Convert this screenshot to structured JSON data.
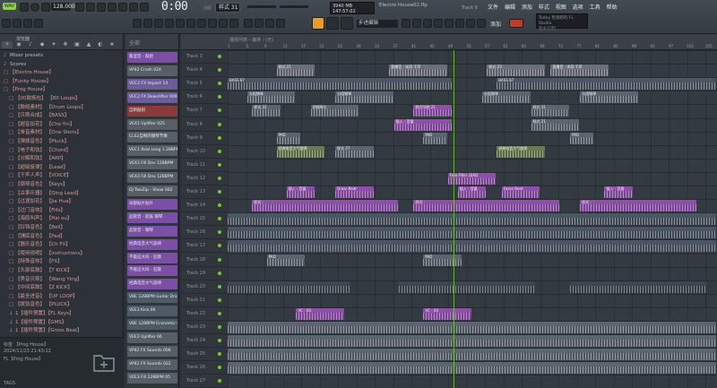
{
  "toolbar": {
    "wave_badge": "WAV",
    "bpm": "128.000",
    "time": "0:00",
    "time_sub": ":00",
    "pattern": "样式 31",
    "cpu_line1": "3940 MB",
    "cpu_line2": "147:57:02",
    "project_title": "Electro House02.flp",
    "track_indicator": "Track 9",
    "step_edit": "步进编辑",
    "add_label": "添加",
    "menu": [
      "文件",
      "编辑",
      "添加",
      "样式",
      "视图",
      "选项",
      "工具",
      "帮助"
    ],
    "news_line1": "Today 检测新的 FL Studio",
    "news_line2": "版本可用!"
  },
  "browser": {
    "title": "浏览器",
    "tabs": [
      "+",
      "◉",
      "♪",
      "◆",
      "✦",
      "❖",
      "▣",
      "▲",
      "◐",
      "★"
    ],
    "items": [
      {
        "glyph": "♪",
        "label": "Mixer presets"
      },
      {
        "glyph": "♪",
        "label": "Scores"
      },
      {
        "glyph": "□",
        "label": "【Electro House】"
      },
      {
        "glyph": "□",
        "label": "【Funky House】"
      },
      {
        "glyph": "□",
        "label": "【Prog House】"
      },
      {
        "glyph": "□",
        "label": "【00鼓族包】 【8X Loops】"
      },
      {
        "glyph": "□",
        "label": "【鼓组素材】 【Drum Loops】"
      },
      {
        "glyph": "□",
        "label": "【贝斯合成】 【BASS】"
      },
      {
        "glyph": "□",
        "label": "【超音加花】 【Che Yin】"
      },
      {
        "glyph": "□",
        "label": "【单音素材】 【One Shots】"
      },
      {
        "glyph": "□",
        "label": "【弹拨音色】 【Pluck】"
      },
      {
        "glyph": "□",
        "label": "【电子和弦】 【Chord】"
      },
      {
        "glyph": "□",
        "label": "【分解和弦】 【ARP】"
      },
      {
        "glyph": "□",
        "label": "【超级旋律】 【Lead】"
      },
      {
        "glyph": "□",
        "label": "【干声人声】 【VOICE】"
      },
      {
        "glyph": "□",
        "label": "【钢琴音色】 【Keys】"
      },
      {
        "glyph": "□",
        "label": "【古筝乐器】 【Qing Lead】"
      },
      {
        "glyph": "□",
        "label": "【过渡加花】 【Jia Hua】"
      },
      {
        "glyph": "□",
        "label": "【过门音效】 【Fills】"
      },
      {
        "glyph": "□",
        "label": "【海鸥叫声】 【Hai ou】"
      },
      {
        "glyph": "□",
        "label": "【铃铛音色】 【Bell】"
      },
      {
        "glyph": "□",
        "label": "【铺底音色】 【Pad】"
      },
      {
        "glyph": "□",
        "label": "【器乐音色】 【Ch FX】"
      },
      {
        "glyph": "□",
        "label": "【使用说明】 【instructions】"
      },
      {
        "glyph": "□",
        "label": "【特殊音效】 【FX】"
      },
      {
        "glyph": "□",
        "label": "【头部底鼓】 【T KICK】"
      },
      {
        "glyph": "□",
        "label": "【秀音贝斯】 【Wang Ying】"
      },
      {
        "glyph": "□",
        "label": "【中间底鼓】 【Z KICK】"
      },
      {
        "glyph": "□",
        "label": "【最全进音】 【UP LOOP】"
      },
      {
        "glyph": "□",
        "label": "【拨弦音色】 【PLUCK】"
      },
      {
        "glyph": "↓",
        "label": "1【插件预置】【FL Keys】"
      },
      {
        "glyph": "↓",
        "label": "1【插件预置】【GMS】"
      },
      {
        "glyph": "↓",
        "label": "1【插件预置】【Gross Beat】"
      }
    ],
    "footer_line1": "标签 【Prog House】",
    "footer_line2": "2024/11/23 21:43:12",
    "footer_line3": "FL【Prog House】",
    "tags": "TAGS"
  },
  "channels": {
    "head": "全部",
    "items": [
      {
        "label": "集混音 - 鼓组",
        "color": "#7b4fa3"
      },
      {
        "label": "VP42 Crash 024",
        "color": "#585e66"
      },
      {
        "label": "VEC2 FX Impact 14",
        "color": "#6c5d9a"
      },
      {
        "label": "VEC2 FX Downlifter 009",
        "color": "#6c5d9a"
      },
      {
        "label": "自制鼓组",
        "color": "#8a3a3a"
      },
      {
        "label": "VEX1 Uplifter 025",
        "color": "#585e66"
      },
      {
        "label": "CLS2自制的钢琴节奏",
        "color": "#585e66"
      },
      {
        "label": "VEC1 Real Long 1.28BPM",
        "color": "#585e66"
      },
      {
        "label": "VEX3 Fill Dev 128BPM",
        "color": "#585e66"
      },
      {
        "label": "VEX3 Fill Dev 128BPM",
        "color": "#585e66"
      },
      {
        "label": "DJ TwoZip - Show 002",
        "color": "#585e66"
      },
      {
        "label": "局部贴片贴片",
        "color": "#7b4fa3"
      },
      {
        "label": "品管音 - 底鼓 钢琴",
        "color": "#7b4fa3"
      },
      {
        "label": "品管音 - 钢琴",
        "color": "#7b4fa3"
      },
      {
        "label": "经典电音大气旋律",
        "color": "#7b4fa3"
      },
      {
        "label": "不能这大码 - 狂歌",
        "color": "#7b4fa3"
      },
      {
        "label": "不能这大码 - 狂歌",
        "color": "#7b4fa3"
      },
      {
        "label": "经典电音大气旋律",
        "color": "#7b4fa3"
      },
      {
        "label": "VBE 128BPM Guitar Dram",
        "color": "#4e5b66"
      },
      {
        "label": "VEE3 Kick 06",
        "color": "#4e5b66"
      },
      {
        "label": "VBE 128BPM Economic Dr",
        "color": "#4e5b66"
      },
      {
        "label": "VEE3 Uplifter 06",
        "color": "#585e66"
      },
      {
        "label": "VP42 FX Sounds 006",
        "color": "#585e66"
      },
      {
        "label": "VP42 FX Sounds 022",
        "color": "#585e66"
      },
      {
        "label": "VEE3 Fill 128BPM 05",
        "color": "#585e66"
      }
    ]
  },
  "playlist": {
    "path": "播放列表 - 编排 › (无)",
    "ruler": [
      "1",
      "5",
      "9",
      "13",
      "17",
      "21",
      "25",
      "29",
      "33",
      "37",
      "41",
      "45",
      "49",
      "53",
      "57",
      "61",
      "65",
      "69",
      "73",
      "77",
      "81",
      "85",
      "89",
      "93",
      "97",
      "101",
      "105"
    ],
    "tracks": [
      "Track 3",
      "Track 4",
      "Track 5",
      "Track 6",
      "Track 7",
      "Track 8",
      "Track 9",
      "Track 10",
      "Track 11",
      "Track 12",
      "Track 13",
      "Track 14",
      "Track 15",
      "Track 16",
      "Track 17",
      "Track 18",
      "Track 19",
      "Track 20",
      "Track 21",
      "Track 22",
      "Track 23",
      "Track 24",
      "Track 25",
      "Track 26",
      "Track 27"
    ],
    "clips": [
      {
        "row": 1,
        "x": 0.1,
        "w": 0.08,
        "color": "#6a6f78",
        "label": "样式 21"
      },
      {
        "row": 1,
        "x": 0.33,
        "w": 0.12,
        "color": "#6a6f78",
        "label": "直播音 - 米奇 干声"
      },
      {
        "row": 1,
        "x": 0.53,
        "w": 0.12,
        "color": "#6a6f78",
        "label": "样式 23"
      },
      {
        "row": 1,
        "x": 0.66,
        "w": 0.12,
        "color": "#6a6f78",
        "label": "直播音 - 米奇 干声"
      },
      {
        "row": 2,
        "x": 0.0,
        "w": 0.46,
        "color": "#4b5563",
        "label": "BASS 87"
      },
      {
        "row": 2,
        "x": 0.55,
        "w": 0.45,
        "color": "#4b5563",
        "label": "BASS 87"
      },
      {
        "row": 3,
        "x": 0.04,
        "w": 0.1,
        "color": "#5c6470",
        "label": "分组钢琴"
      },
      {
        "row": 3,
        "x": 0.22,
        "w": 0.12,
        "color": "#5c6470",
        "label": "分组钢琴"
      },
      {
        "row": 3,
        "x": 0.52,
        "w": 0.1,
        "color": "#5c6470",
        "label": "分组钢琴"
      },
      {
        "row": 3,
        "x": 0.72,
        "w": 0.12,
        "color": "#5c6470",
        "label": "分组钢琴"
      },
      {
        "row": 4,
        "x": 0.05,
        "w": 0.06,
        "color": "#5c6470",
        "label": "样式 31"
      },
      {
        "row": 4,
        "x": 0.17,
        "w": 0.1,
        "color": "#5c6470",
        "label": "拍钢琴大"
      },
      {
        "row": 4,
        "x": 0.38,
        "w": 0.08,
        "color": "#8d4fa8",
        "label": "样式节拍 21"
      },
      {
        "row": 4,
        "x": 0.62,
        "w": 0.08,
        "color": "#5c6470",
        "label": "样式 31"
      },
      {
        "row": 5,
        "x": 0.34,
        "w": 0.12,
        "color": "#8d4fa8",
        "label": "插入 - 音量"
      },
      {
        "row": 5,
        "x": 0.62,
        "w": 0.1,
        "color": "#5c6470",
        "label": "样式 21"
      },
      {
        "row": 6,
        "x": 0.1,
        "w": 0.05,
        "color": "#5c6470",
        "label": "PAD"
      },
      {
        "row": 6,
        "x": 0.4,
        "w": 0.05,
        "color": "#5c6470",
        "label": "PAD"
      },
      {
        "row": 6,
        "x": 0.7,
        "w": 0.05,
        "color": "#5c6470",
        "label": "PAD"
      },
      {
        "row": 7,
        "x": 0.1,
        "w": 0.1,
        "color": "#6b7b4f",
        "label": "经典电音大气旋律"
      },
      {
        "row": 7,
        "x": 0.22,
        "w": 0.08,
        "color": "#5c6470",
        "label": "样式 27"
      },
      {
        "row": 7,
        "x": 0.55,
        "w": 0.1,
        "color": "#6b7b4f",
        "label": "经典电音大气旋律"
      },
      {
        "row": 9,
        "x": 0.45,
        "w": 0.1,
        "color": "#8d4fa8",
        "label": "Free Filter LEAD"
      },
      {
        "row": 10,
        "x": 0.12,
        "w": 0.06,
        "color": "#8d4fa8",
        "label": "插入 - 音量"
      },
      {
        "row": 10,
        "x": 0.22,
        "w": 0.08,
        "color": "#8d4fa8",
        "label": "Gross Beat"
      },
      {
        "row": 10,
        "x": 0.47,
        "w": 0.06,
        "color": "#8d4fa8",
        "label": "插入 - 音量"
      },
      {
        "row": 10,
        "x": 0.56,
        "w": 0.08,
        "color": "#8d4fa8",
        "label": "Gross Beat"
      },
      {
        "row": 10,
        "x": 0.77,
        "w": 0.06,
        "color": "#8d4fa8",
        "label": "插入 - 音量"
      },
      {
        "row": 11,
        "x": 0.05,
        "w": 0.3,
        "color": "#8d4fa8",
        "label": "样式 -"
      },
      {
        "row": 11,
        "x": 0.38,
        "w": 0.3,
        "color": "#8d4fa8",
        "label": "样式 -"
      },
      {
        "row": 11,
        "x": 0.72,
        "w": 0.24,
        "color": "#8d4fa8",
        "label": "样式 -"
      },
      {
        "row": 12,
        "x": 0.0,
        "w": 1.0,
        "color": "#4b5563",
        "label": ""
      },
      {
        "row": 13,
        "x": 0.0,
        "w": 1.0,
        "color": "#4b5563",
        "label": ""
      },
      {
        "row": 14,
        "x": 0.0,
        "w": 1.0,
        "color": "#4b5563",
        "label": ""
      },
      {
        "row": 15,
        "x": 0.08,
        "w": 0.08,
        "color": "#5c6470",
        "label": "PAD"
      },
      {
        "row": 15,
        "x": 0.4,
        "w": 0.08,
        "color": "#5c6470",
        "label": "PAD"
      },
      {
        "row": 17,
        "x": 0.0,
        "w": 0.25,
        "color": "#3d4650",
        "label": ""
      },
      {
        "row": 17,
        "x": 0.35,
        "w": 0.28,
        "color": "#3d4650",
        "label": ""
      },
      {
        "row": 17,
        "x": 0.7,
        "w": 0.28,
        "color": "#3d4650",
        "label": ""
      },
      {
        "row": 19,
        "x": 0.14,
        "w": 0.1,
        "color": "#8d4fa8",
        "label": "VC - 03"
      },
      {
        "row": 19,
        "x": 0.4,
        "w": 0.1,
        "color": "#8d4fa8",
        "label": "VC - 03"
      },
      {
        "row": 20,
        "x": 0.0,
        "w": 1.0,
        "color": "#5c6470",
        "label": ""
      },
      {
        "row": 21,
        "x": 0.0,
        "w": 1.0,
        "color": "#5c6470",
        "label": ""
      },
      {
        "row": 22,
        "x": 0.0,
        "w": 1.0,
        "color": "#5c6470",
        "label": ""
      },
      {
        "row": 23,
        "x": 0.0,
        "w": 1.0,
        "color": "#5c6470",
        "label": ""
      }
    ]
  },
  "colors": {
    "accent": "#79c43b",
    "pattern_purple": "#8d4fa8"
  }
}
